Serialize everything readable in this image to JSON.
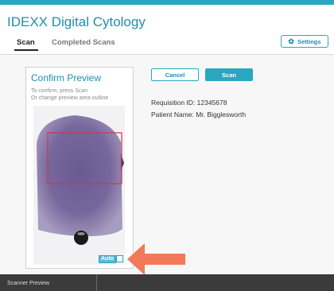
{
  "app": {
    "title": "IDEXX Digital Cytology"
  },
  "tabs": [
    {
      "label": "Scan",
      "active": true
    },
    {
      "label": "Completed Scans",
      "active": false
    }
  ],
  "settings": {
    "label": "Settings",
    "icon": "gear-icon"
  },
  "preview": {
    "title": "Confirm Preview",
    "help": "To confirm, press Scan\nOr change preview area outline",
    "auto_label": "Auto"
  },
  "actions": {
    "cancel_label": "Cancel",
    "scan_label": "Scan"
  },
  "requisition": {
    "text": "Requisition ID: 12345678"
  },
  "patient": {
    "text": "Patient Name: Mr. Bigglesworth"
  },
  "bottom": {
    "label": "Scanner Preview"
  },
  "colors": {
    "accent": "#2aa7c0",
    "selection": "#c43b4e",
    "arrow": "#f07a5a",
    "footer": "#3b3b3b"
  }
}
